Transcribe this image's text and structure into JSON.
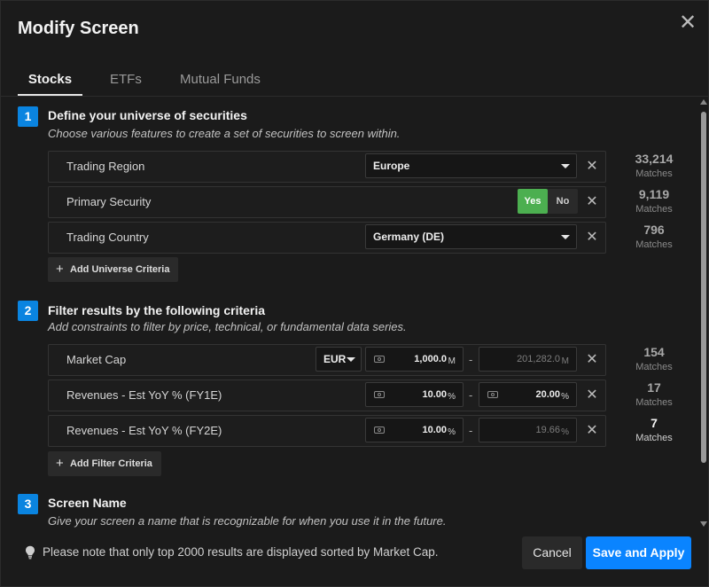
{
  "dialog": {
    "title": "Modify Screen",
    "close_label": "✕"
  },
  "tabs": [
    {
      "label": "Stocks",
      "active": true
    },
    {
      "label": "ETFs",
      "active": false
    },
    {
      "label": "Mutual Funds",
      "active": false
    }
  ],
  "step1": {
    "number": "1",
    "title": "Define your universe of securities",
    "subtitle": "Choose various features to create a set of securities to screen within.",
    "rows": [
      {
        "label": "Trading Region",
        "value": "Europe",
        "matches": "33,214",
        "matches_label": "Matches"
      },
      {
        "label": "Primary Security",
        "yes": "Yes",
        "no": "No",
        "selected": "Yes",
        "matches": "9,119",
        "matches_label": "Matches"
      },
      {
        "label": "Trading Country",
        "value": "Germany (DE)",
        "matches": "796",
        "matches_label": "Matches"
      }
    ],
    "add_button": "Add Universe Criteria"
  },
  "step2": {
    "number": "2",
    "title": "Filter results by the following criteria",
    "subtitle": "Add constraints to filter by price, technical, or fundamental data series.",
    "rows": [
      {
        "label": "Market Cap",
        "currency": "EUR",
        "min": "1,000.0",
        "min_unit": "M",
        "max": "201,282.0",
        "max_unit": "M",
        "max_dim": true,
        "matches": "154",
        "matches_label": "Matches"
      },
      {
        "label": "Revenues - Est YoY % (FY1E)",
        "min": "10.00",
        "min_unit": "%",
        "max": "20.00",
        "max_unit": "%",
        "max_dim": false,
        "matches": "17",
        "matches_label": "Matches"
      },
      {
        "label": "Revenues - Est YoY % (FY2E)",
        "min": "10.00",
        "min_unit": "%",
        "max": "19.66",
        "max_unit": "%",
        "max_dim": true,
        "matches": "7",
        "matches_label": "Matches"
      }
    ],
    "add_button": "Add Filter Criteria"
  },
  "step3": {
    "number": "3",
    "title": "Screen Name",
    "subtitle": "Give your screen a name that is recognizable for when you use it in the future."
  },
  "footer": {
    "note": "Please note that only top 2000 results are displayed sorted by Market Cap.",
    "cancel": "Cancel",
    "save": "Save and Apply"
  },
  "colors": {
    "accent": "#0a84ff",
    "yes_green": "#4caf50",
    "step_badge": "#0a84e0"
  }
}
